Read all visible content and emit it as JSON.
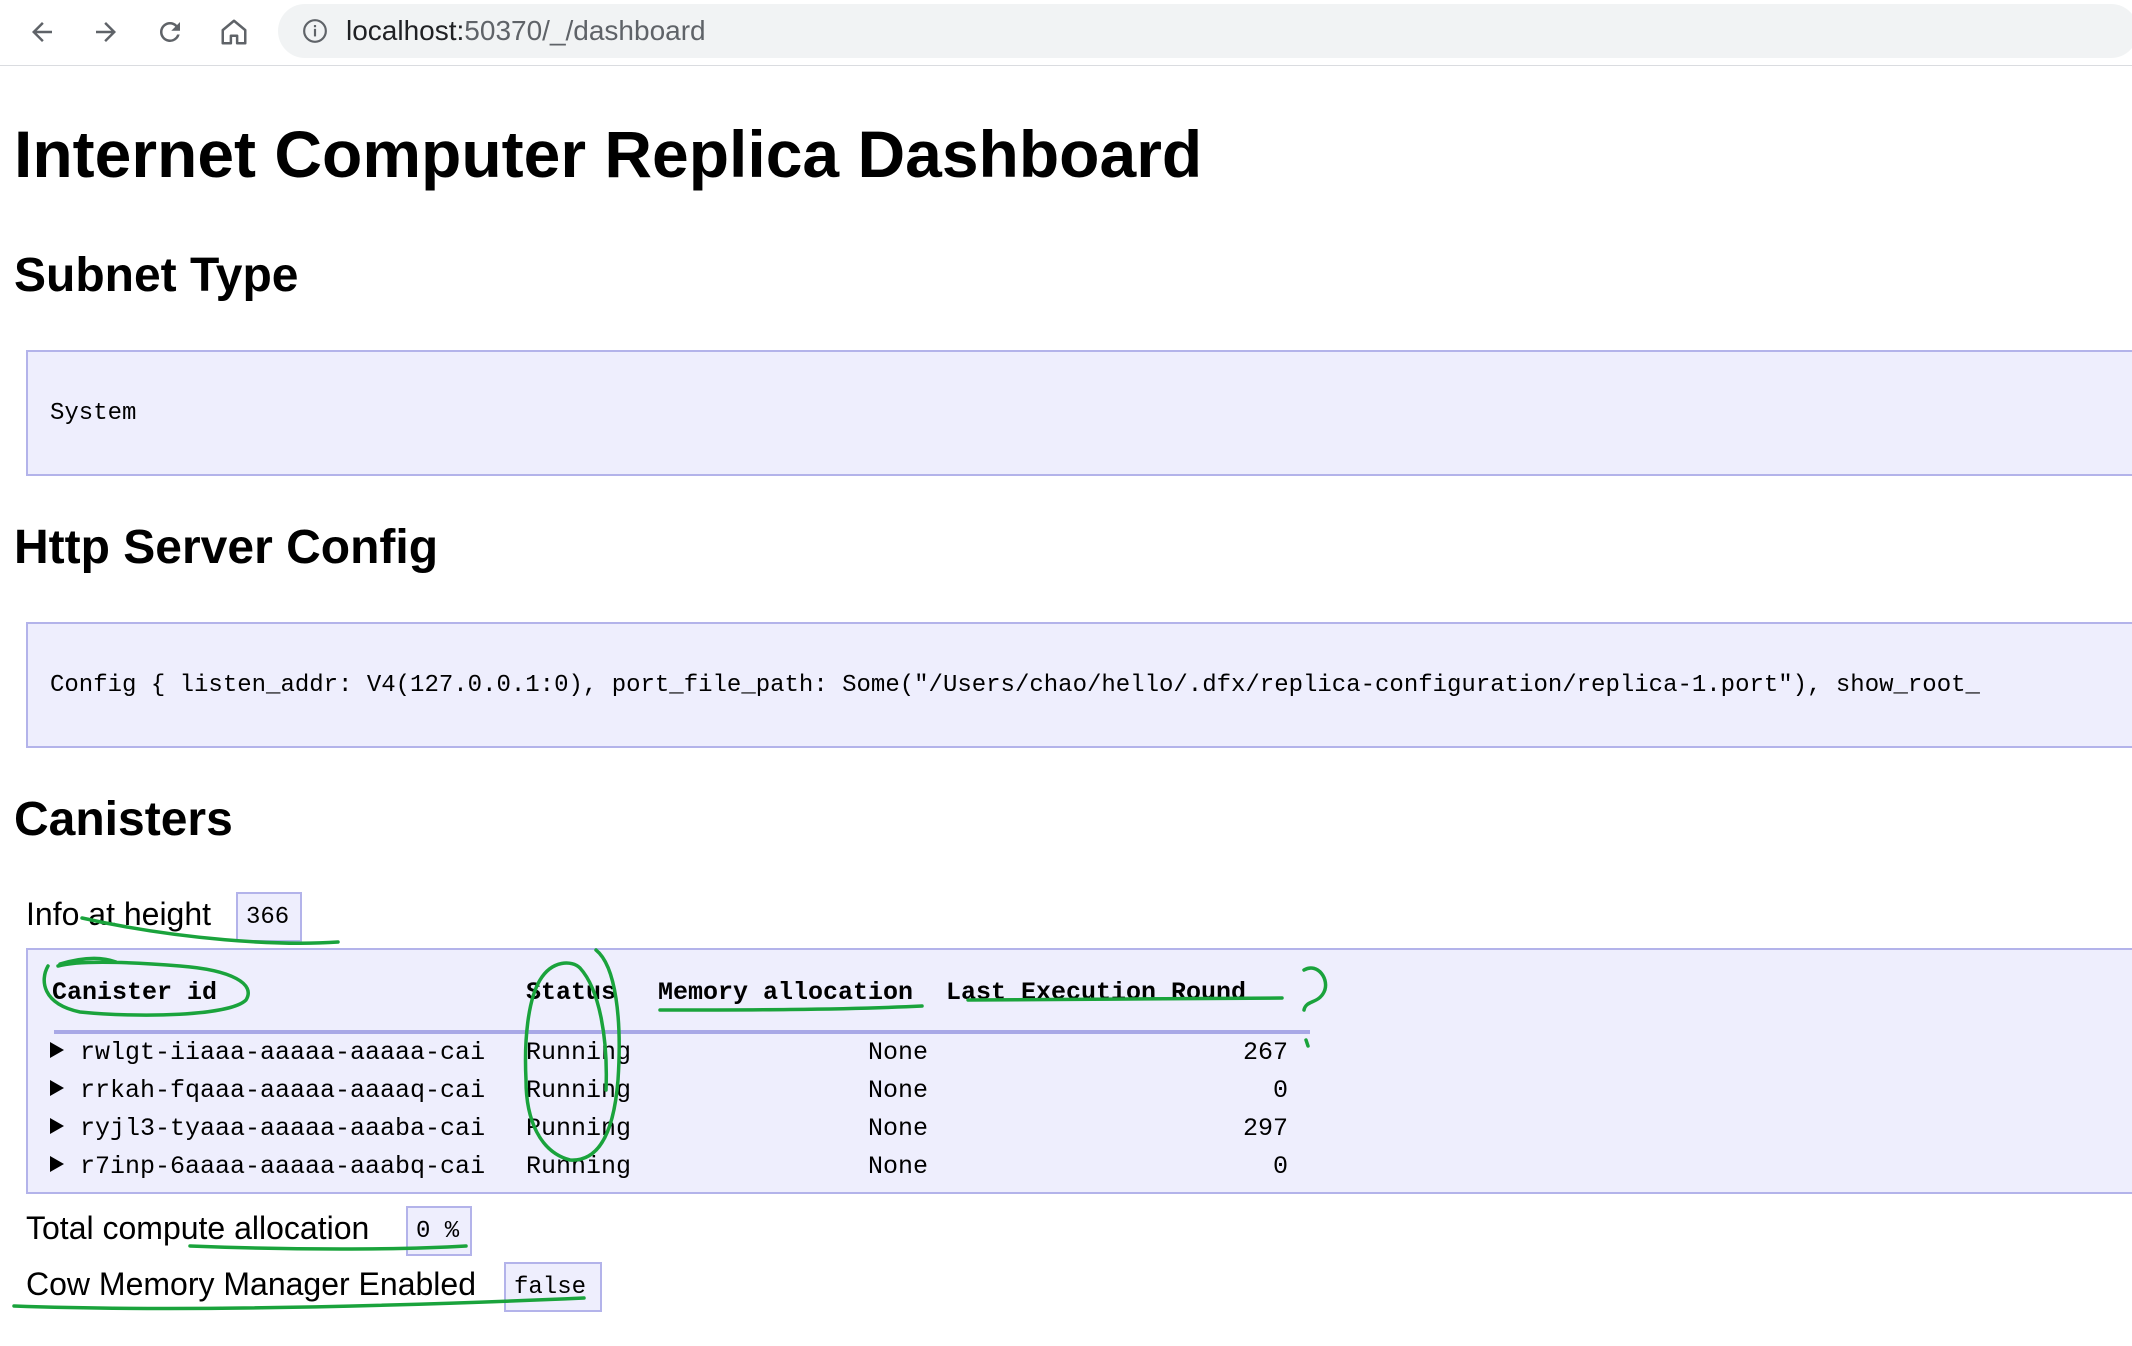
{
  "browser": {
    "url_host": "localhost:",
    "url_rest": "50370/_/dashboard"
  },
  "page": {
    "title": "Internet Computer Replica Dashboard",
    "subnet_type": {
      "heading": "Subnet Type",
      "value": "System"
    },
    "http_config": {
      "heading": "Http Server Config",
      "value": "Config { listen_addr: V4(127.0.0.1:0), port_file_path: Some(\"/Users/chao/hello/.dfx/replica-configuration/replica-1.port\"), show_root_"
    },
    "canisters": {
      "heading": "Canisters",
      "info_label": "Info at height",
      "height": "366",
      "columns": [
        "Canister id",
        "Status",
        "Memory allocation",
        "Last Execution Round"
      ],
      "rows": [
        {
          "id": "rwlgt-iiaaa-aaaaa-aaaaa-cai",
          "status": "Running",
          "memory": "None",
          "round": "267"
        },
        {
          "id": "rrkah-fqaaa-aaaaa-aaaaq-cai",
          "status": "Running",
          "memory": "None",
          "round": "0"
        },
        {
          "id": "ryjl3-tyaaa-aaaaa-aaaba-cai",
          "status": "Running",
          "memory": "None",
          "round": "297"
        },
        {
          "id": "r7inp-6aaaa-aaaaa-aaabq-cai",
          "status": "Running",
          "memory": "None",
          "round": "0"
        }
      ],
      "total_compute_label": "Total compute allocation",
      "total_compute_value": "0 %",
      "cow_label": "Cow Memory Manager Enabled",
      "cow_value": "false"
    }
  },
  "colors": {
    "box_bg": "#eeeefd",
    "box_border": "#b3b3ea",
    "annotation": "#1aa33c"
  },
  "annotation_text": "?"
}
